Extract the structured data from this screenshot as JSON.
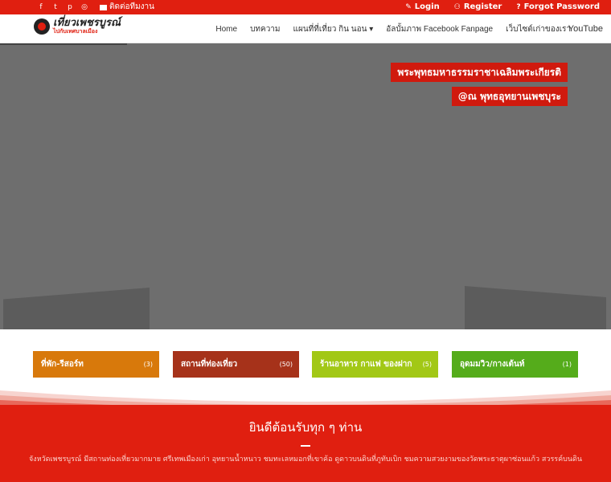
{
  "topbar": {
    "social": [
      {
        "icon": "facebook-icon",
        "glyph": "f"
      },
      {
        "icon": "twitter-icon",
        "glyph": "t"
      },
      {
        "icon": "pinterest-icon",
        "glyph": "p"
      },
      {
        "icon": "instagram-icon",
        "glyph": "◎"
      }
    ],
    "contact_label": "ติดต่อทีมงาน",
    "login_label": "Login",
    "register_label": "Register",
    "forgot_label": "Forgot Password"
  },
  "navbar": {
    "logo_title": "เที่ยวเพชรบูรณ์",
    "logo_subtitle": "ไปกับเทศบาลเมือง",
    "menu": [
      {
        "label": "Home"
      },
      {
        "label": "บทความ"
      },
      {
        "label": "แผนที่ที่เที่ยว กิน นอน ▾"
      },
      {
        "label": "อัลบั้มภาพ Facebook Fanpage"
      },
      {
        "label": "เว็บไซต์เก่าของเรา"
      }
    ],
    "youtube_label": "YouTube"
  },
  "hero": {
    "caption_line1": "พระพุทธมหาธรรมราชาเฉลิมพระเกียรติ",
    "caption_line2": "@ณ พุทธอุทยานเพชบุระ"
  },
  "categories": [
    {
      "label": "ที่พัก-รีสอร์ท",
      "count": "(3)",
      "color": "#d8790b"
    },
    {
      "label": "สถานที่ท่องเที่ยว",
      "count": "(50)",
      "color": "#a6321a"
    },
    {
      "label": "ร้านอาหาร กาแฟ ของฝาก",
      "count": "(5)",
      "color": "#a2c816"
    },
    {
      "label": "อุดมมวิว/กางเต้นท์",
      "count": "(1)",
      "color": "#55ac1b"
    }
  ],
  "welcome": {
    "title": "ยินดีต้อนรับทุก ๆ ท่าน",
    "description": "จังหวัดเพชรบูรณ์ มีสถานท่องเที่ยวมากมาย ศรีเทพเมืองเก่า อุทยานน้ำหนาว ชมทะเลหมอกที่เขาค้อ ดูดาวบนดินที่ภูทับเบิก ชมความสวยงามของวัดพระธาตุผาซ่อนแก้ว สวรรค์บนดิน"
  },
  "colors": {
    "brand_red": "#e01f10",
    "caption_red": "#d01a0e",
    "hero_gray": "#6e6e6e"
  }
}
